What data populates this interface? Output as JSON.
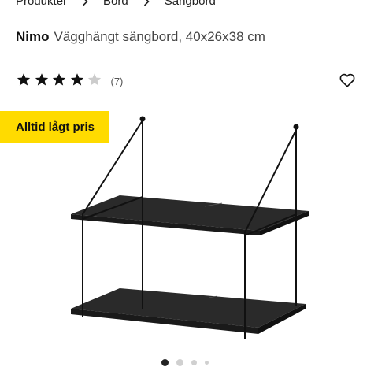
{
  "breadcrumb": {
    "items": [
      {
        "label": "Produkter"
      },
      {
        "label": "Bord"
      },
      {
        "label": "Sängbord"
      }
    ]
  },
  "product": {
    "name": "Nimo",
    "description": "Vägghängt sängbord, 40x26x38 cm",
    "rating": 4,
    "rating_max": 5,
    "review_count": "(7)"
  },
  "badge": {
    "label": "Alltid lågt pris"
  },
  "carousel": {
    "count": 4,
    "active_index": 0
  },
  "icons": {
    "breadcrumb_separator": "chevron-right-icon",
    "favorite": "heart-outline-icon",
    "star": "star-icon"
  },
  "colors": {
    "badge_bg": "#ffdb00",
    "text": "#111111",
    "star_filled": "#111111",
    "star_empty": "#cccccc",
    "dot_active": "#222222",
    "dot_inactive": "#d0d0d0"
  }
}
